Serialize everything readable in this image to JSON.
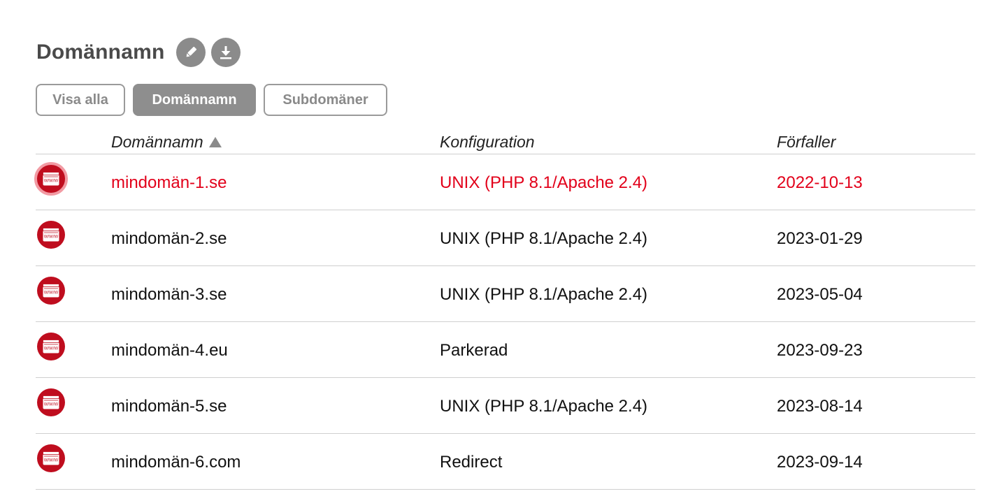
{
  "header": {
    "title": "Domännamn",
    "edit_icon": "pencil-icon",
    "download_icon": "download-icon"
  },
  "filters": {
    "show_all": "Visa alla",
    "domains": "Domännamn",
    "subdomains": "Subdomäner",
    "active": "Domännamn"
  },
  "table": {
    "columns": {
      "domain": "Domännamn",
      "config": "Konfiguration",
      "expires": "Förfaller"
    },
    "sort": {
      "column": "domain",
      "direction": "ascending"
    },
    "rows": [
      {
        "domain": "mindomän-1.se",
        "config": "UNIX (PHP 8.1/Apache 2.4)",
        "expires": "2022-10-13",
        "status": "expired",
        "icon": "www-icon"
      },
      {
        "domain": "mindomän-2.se",
        "config": "UNIX (PHP 8.1/Apache 2.4)",
        "expires": "2023-01-29",
        "status": "active",
        "icon": "www-icon"
      },
      {
        "domain": "mindomän-3.se",
        "config": "UNIX (PHP 8.1/Apache 2.4)",
        "expires": "2023-05-04",
        "status": "active",
        "icon": "www-icon"
      },
      {
        "domain": "mindomän-4.eu",
        "config": "Parkerad",
        "expires": "2023-09-23",
        "status": "active",
        "icon": "www-icon"
      },
      {
        "domain": "mindomän-5.se",
        "config": "UNIX (PHP 8.1/Apache 2.4)",
        "expires": "2023-08-14",
        "status": "active",
        "icon": "www-icon"
      },
      {
        "domain": "mindomän-6.com",
        "config": "Redirect",
        "expires": "2023-09-14",
        "status": "active",
        "icon": "www-icon"
      }
    ]
  },
  "colors": {
    "expired_text": "#e2001a",
    "icon_bg": "#bf0d1e",
    "icon_ring": "#f29aa3",
    "button_gray": "#8e8e8e"
  }
}
